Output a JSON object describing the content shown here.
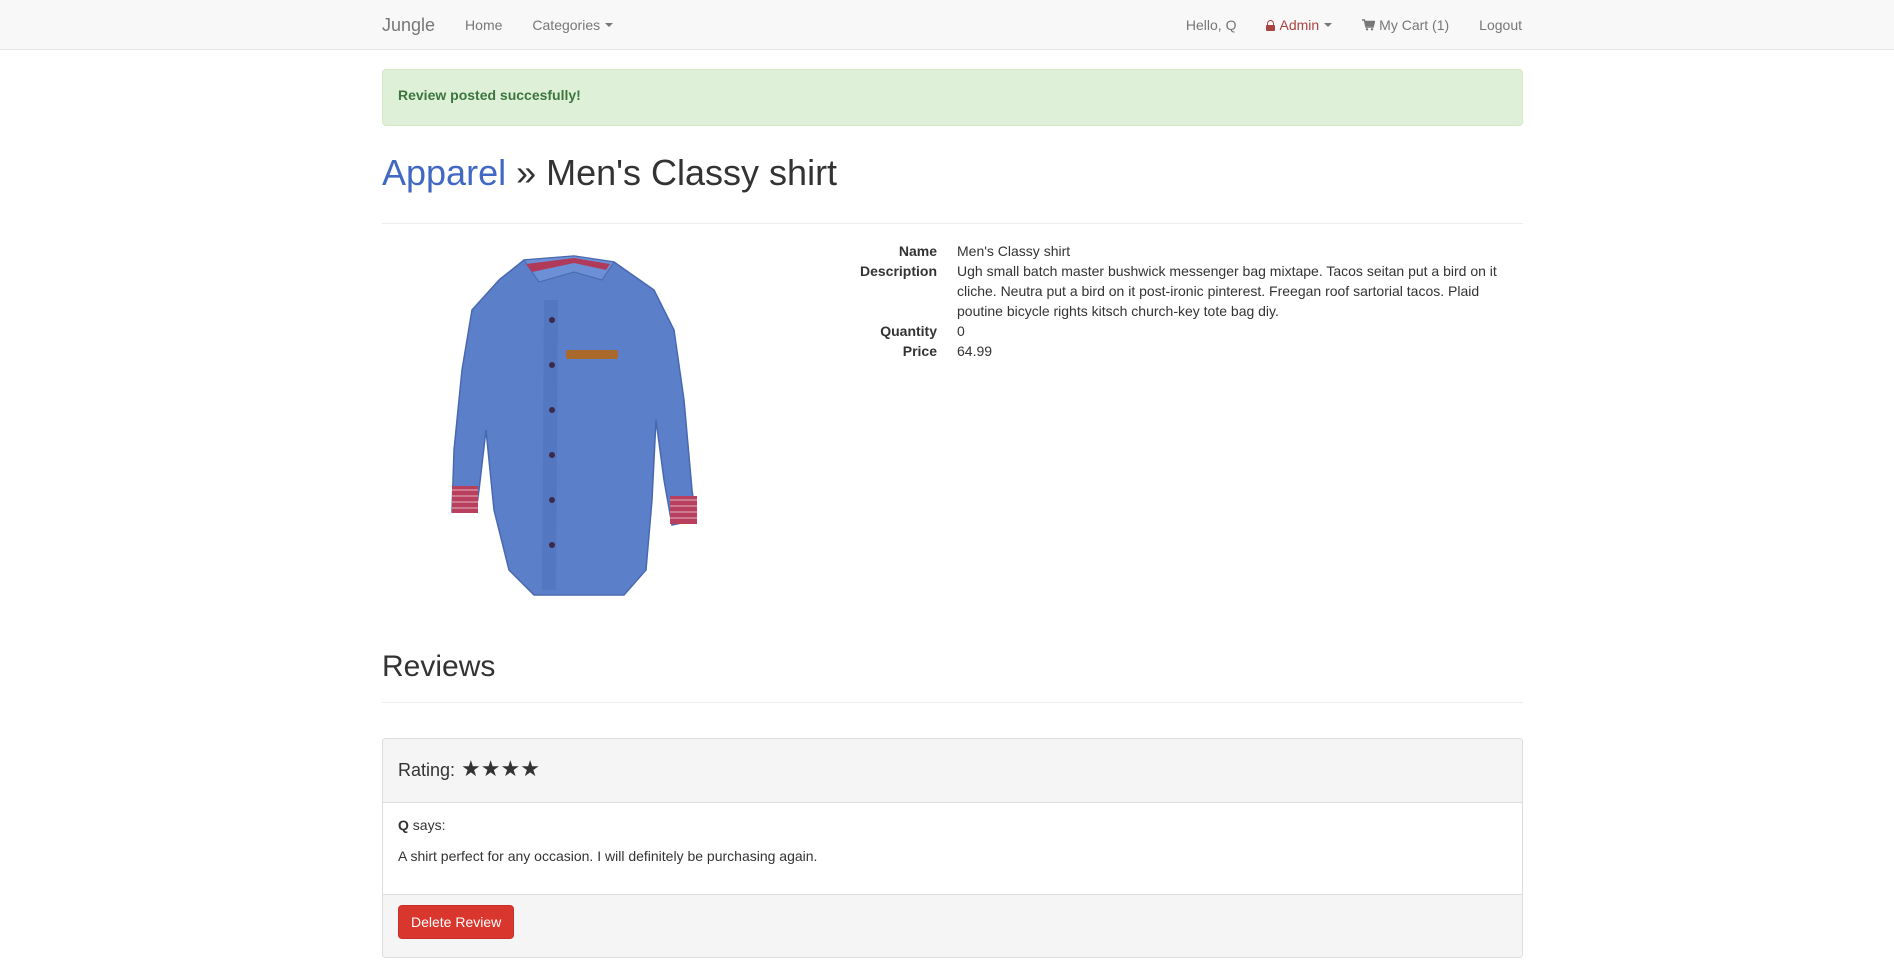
{
  "navbar": {
    "brand": "Jungle",
    "home": "Home",
    "categories": "Categories",
    "greeting": "Hello, Q",
    "admin": "Admin",
    "cart": "My Cart (1)",
    "logout": "Logout"
  },
  "alert": {
    "message": "Review posted succesfully!"
  },
  "header": {
    "category": "Apparel",
    "separator": " » ",
    "product": "Men's Classy shirt"
  },
  "product": {
    "labels": {
      "name": "Name",
      "description": "Description",
      "quantity": "Quantity",
      "price": "Price"
    },
    "name": "Men's Classy shirt",
    "description": "Ugh small batch master bushwick messenger bag mixtape. Tacos seitan put a bird on it cliche. Neutra put a bird on it post-ironic pinterest. Freegan roof sartorial tacos. Plaid poutine bicycle rights kitsch church-key tote bag diy.",
    "quantity": "0",
    "price": "64.99"
  },
  "reviews": {
    "title": "Reviews",
    "items": [
      {
        "rating_label": "Rating:",
        "stars": "★★★★",
        "author": "Q",
        "says": " says:",
        "text": "A shirt perfect for any occasion. I will definitely be purchasing again.",
        "delete_label": "Delete Review"
      }
    ]
  },
  "colors": {
    "link": "#4169c4",
    "admin": "#a94442",
    "alert_bg": "#dff0d8",
    "alert_text": "#3c763d",
    "danger": "#d9372e",
    "shirt": "#5b7fc9"
  }
}
